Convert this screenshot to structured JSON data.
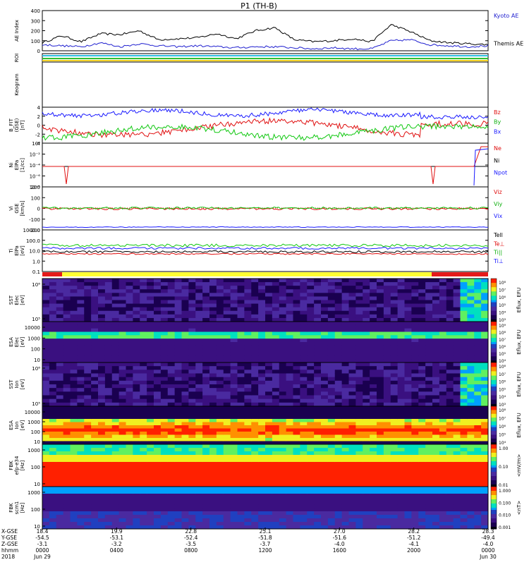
{
  "title": "P1 (TH-B)",
  "colors": {
    "blue": "#1a1aff",
    "red": "#e01010",
    "green": "#10c810",
    "black": "#000000",
    "yellow": "#ffff00",
    "roi_bar_red": "#e41a1a",
    "roi_bar_yellow": "#ffff33"
  },
  "panels": [
    {
      "id": "ae",
      "ylabel": "AE Index",
      "ticks": [
        "400",
        "300",
        "200",
        "100",
        "0"
      ],
      "legend": [
        {
          "text": "Kyoto AE",
          "color": "#2020d0"
        },
        {
          "text": "Themis AE",
          "color": "#000000"
        }
      ]
    },
    {
      "id": "roi",
      "ylabel": "ROI",
      "ticks": [],
      "legend": []
    },
    {
      "id": "keogram",
      "ylabel": "Keogram",
      "ticks": [],
      "legend": []
    },
    {
      "id": "bfield",
      "ylabel": "B_FIT\n(GSE)\n[nT]",
      "ticks": [
        "4",
        "2",
        "0",
        "-2",
        "-4"
      ],
      "legend": [
        {
          "text": "Bz",
          "color": "#e01010"
        },
        {
          "text": "By",
          "color": "#10b010"
        },
        {
          "text": "Bx",
          "color": "#1a1aff"
        }
      ]
    },
    {
      "id": "density",
      "ylabel": "Ni\nElPa\n[1/cc]",
      "ticks": [
        "10⁰",
        "10⁻²",
        "10⁻⁴",
        "10⁻⁶",
        "10⁻⁸"
      ],
      "legend": [
        {
          "text": "Ne",
          "color": "#e01010"
        },
        {
          "text": "Ni",
          "color": "#000000"
        },
        {
          "text": "Npot",
          "color": "#1a1aff"
        }
      ]
    },
    {
      "id": "velocity",
      "ylabel": "Vi\nGSE\n[km/s]",
      "ticks": [
        "200",
        "100",
        "0",
        "-100",
        "-200"
      ],
      "legend": [
        {
          "text": "Viz",
          "color": "#e01010"
        },
        {
          "text": "Viy",
          "color": "#10b010"
        },
        {
          "text": "Vix",
          "color": "#1a1aff"
        }
      ]
    },
    {
      "id": "temp",
      "ylabel": "Ti\nElPa\n[eV]",
      "ticks": [
        "1000.0",
        "100.0",
        "10.0",
        "1.0",
        "0.1"
      ],
      "legend": [
        {
          "text": "Tell",
          "color": "#000000"
        },
        {
          "text": "Te⊥",
          "color": "#e01010"
        },
        {
          "text": "Ti||",
          "color": "#10b010"
        },
        {
          "text": "Ti⊥",
          "color": "#1a1aff"
        }
      ]
    }
  ],
  "spectrograms": [
    {
      "id": "sst_e",
      "ylabel": "SST\nElec\n[eV]",
      "ticks": [
        "10⁶",
        "10⁵"
      ],
      "cb_label": "Eflux, EFU",
      "cb_ticks": [
        "10⁸",
        "10⁷",
        "10⁶",
        "10⁵",
        "10⁴",
        "10³"
      ]
    },
    {
      "id": "esa_e",
      "ylabel": "ESA\nElec\n[eV]",
      "ticks": [
        "10000",
        "1000",
        "100",
        "10"
      ],
      "cb_label": "Eflux, EFU",
      "cb_ticks": [
        "10⁹",
        "10⁸",
        "10⁷",
        "10⁶",
        "10⁵",
        "10⁴"
      ]
    },
    {
      "id": "sst_i",
      "ylabel": "SST\nIon\n[eV]",
      "ticks": [
        "10⁶",
        "10⁵"
      ],
      "cb_label": "Eflux, EFU",
      "cb_ticks": [
        "10⁸",
        "10⁷",
        "10⁶",
        "10⁵",
        "10⁴",
        "10³"
      ]
    },
    {
      "id": "esa_i",
      "ylabel": "ESA\nIon\n[eV]",
      "ticks": [
        "10000",
        "1000",
        "100",
        "10"
      ],
      "cb_label": "Eflux, EFU",
      "cb_ticks": [
        "10⁸",
        "10⁷",
        "10⁶",
        "10⁵",
        "10⁴"
      ]
    },
    {
      "id": "fbk_e",
      "ylabel": "FBK\nefp-e34\n[Hz]",
      "ticks": [
        "1000",
        "100",
        "10"
      ],
      "cb_label": "<mV/m>",
      "cb_ticks": [
        "1.00",
        "0.10",
        "0.01"
      ]
    },
    {
      "id": "fbk_b",
      "ylabel": "FBK\nscm1\n[Hz]",
      "ticks": [
        "1000",
        "100",
        "10"
      ],
      "cb_label": "<nT>",
      "cb_ticks": [
        "1.000",
        "0.100",
        "0.010",
        "0.001"
      ]
    }
  ],
  "footer": {
    "row_labels": [
      "X-GSE",
      "Y-GSE",
      "Z-GSE",
      "hhmm",
      "2018"
    ],
    "columns": [
      [
        "18.4",
        "-54.5",
        "-3.1",
        "0000",
        "Jun 29"
      ],
      [
        "19.9",
        "-53.1",
        "-3.2",
        "0400",
        ""
      ],
      [
        "22.8",
        "-52.4",
        "-3.5",
        "0800",
        ""
      ],
      [
        "25.1",
        "-51.8",
        "-3.7",
        "1200",
        ""
      ],
      [
        "27.0",
        "-51.6",
        "-4.0",
        "1600",
        ""
      ],
      [
        "28.2",
        "-51.2",
        "-4.1",
        "2000",
        ""
      ],
      [
        "28.3",
        "-49.4",
        "-4.0",
        "0000",
        "Jun 30"
      ]
    ]
  },
  "chart_data": {
    "type": "line",
    "title": "P1 (TH-B)",
    "x_ticks": [
      "0000",
      "0400",
      "0800",
      "1200",
      "1600",
      "2000",
      "0000"
    ],
    "series": [
      {
        "name": "Kyoto AE",
        "values": [
          80,
          150,
          90,
          170,
          160,
          200,
          110,
          120,
          130,
          170,
          120,
          200,
          230,
          110,
          90,
          100,
          120,
          90,
          260,
          190,
          100,
          80,
          70,
          60
        ]
      },
      {
        "name": "Themis AE",
        "values": [
          60,
          50,
          40,
          80,
          40,
          70,
          50,
          40,
          50,
          40,
          30,
          40,
          40,
          30,
          20,
          30,
          20,
          20,
          100,
          110,
          60,
          50,
          40,
          50
        ]
      }
    ],
    "ylim": [
      0,
      400
    ]
  }
}
